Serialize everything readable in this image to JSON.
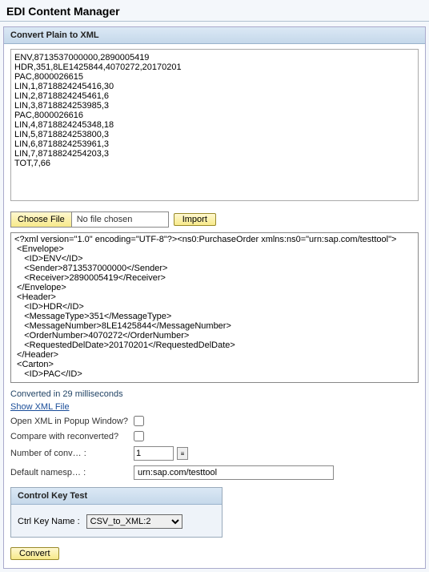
{
  "app_title": "EDI Content Manager",
  "panel_title": "Convert Plain to XML",
  "plain_text": "ENV,8713537000000,2890005419\nHDR,351,8LE1425844,4070272,20170201\nPAC,8000026615\nLIN,1,8718824245416,30\nLIN,2,8718824245461,6\nLIN,3,8718824253985,3\nPAC,8000026616\nLIN,4,8718824245348,18\nLIN,5,8718824253800,3\nLIN,6,8718824253961,3\nLIN,7,8718824254203,3\nTOT,7,66",
  "file": {
    "choose_label": "Choose File",
    "file_name": "No file chosen",
    "import_label": "Import"
  },
  "xml_output": "<?xml version=\"1.0\" encoding=\"UTF-8\"?><ns0:PurchaseOrder xmlns:ns0=\"urn:sap.com/testtool\">\n <Envelope>\n    <ID>ENV</ID>\n    <Sender>8713537000000</Sender>\n    <Receiver>2890005419</Receiver>\n </Envelope>\n <Header>\n    <ID>HDR</ID>\n    <MessageType>351</MessageType>\n    <MessageNumber>8LE1425844</MessageNumber>\n    <OrderNumber>4070272</OrderNumber>\n    <RequestedDelDate>20170201</RequestedDelDate>\n </Header>\n <Carton>\n    <ID>PAC</ID>",
  "status_line": "Converted in 29 milliseconds",
  "show_xml_link": "Show XML File",
  "open_popup_label": "Open XML in Popup Window?",
  "compare_label": "Compare with reconverted?",
  "num_conv_label": "Number of conv… :",
  "num_conv_value": "1",
  "default_ns_label": "Default namesp… :",
  "default_ns_value": "urn:sap.com/testtool",
  "control_key": {
    "panel_title": "Control Key Test",
    "label": "Ctrl Key Name :",
    "selected": "CSV_to_XML:2"
  },
  "convert_label": "Convert"
}
